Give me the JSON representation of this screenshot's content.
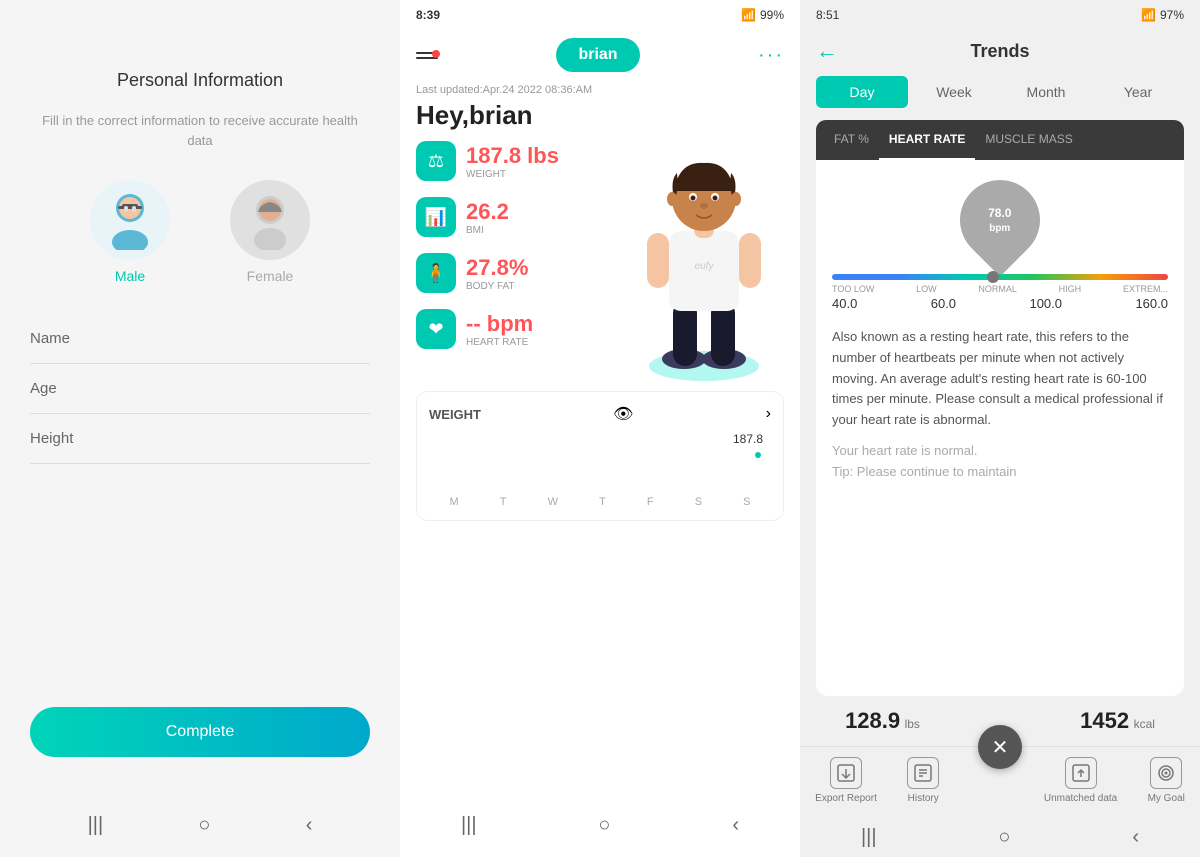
{
  "panel1": {
    "title": "Personal Information",
    "subtitle": "Fill in the correct information to receive accurate health data",
    "genders": [
      {
        "label": "Male",
        "active": true
      },
      {
        "label": "Female",
        "active": false
      }
    ],
    "fields": [
      {
        "label": "Name",
        "placeholder": "Name"
      },
      {
        "label": "Age",
        "placeholder": "Age"
      },
      {
        "label": "Height",
        "placeholder": "Height"
      }
    ],
    "complete_btn": "Complete",
    "nav": [
      "|||",
      "○",
      "‹"
    ]
  },
  "panel2": {
    "status_bar": {
      "time": "8:39",
      "battery": "99%"
    },
    "user_name": "brian",
    "last_updated": "Last updated:Apr.24 2022 08:36:AM",
    "greeting": "Hey,brian",
    "metrics": [
      {
        "icon": "⚖",
        "value": "187.8 lbs",
        "label": "WEIGHT"
      },
      {
        "icon": "📊",
        "value": "26.2",
        "label": "BMI"
      },
      {
        "icon": "🧍",
        "value": "27.8%",
        "label": "Body Fat"
      },
      {
        "icon": "❤",
        "value": "-- bpm",
        "label": "Heart Rate"
      }
    ],
    "weight_section": {
      "title": "WEIGHT",
      "value": "187.8",
      "days": [
        "M",
        "T",
        "W",
        "T",
        "F",
        "S",
        "S"
      ]
    },
    "nav": [
      "|||",
      "○",
      "‹"
    ]
  },
  "panel3": {
    "status_bar": {
      "time": "8:51",
      "battery": "97%"
    },
    "title": "Trends",
    "period_tabs": [
      "Day",
      "Week",
      "Month",
      "Year"
    ],
    "active_period": "Day",
    "metric_tabs": [
      "FAT %",
      "HEART RATE",
      "MUSCLE MASS"
    ],
    "active_metric": "HEART RATE",
    "heart_rate": {
      "value": "78.0",
      "unit": "bpm",
      "gauge_labels": [
        "TOO LOW",
        "LOW",
        "NORMAL",
        "HIGH",
        "EXTREM..."
      ],
      "gauge_numbers": [
        "40.0",
        "60.0",
        "100.0",
        "160.0"
      ],
      "description": "Also known as a resting heart rate, this refers to the number of heartbeats per minute when not actively moving. An average adult's resting heart rate is 60-100 times per minute. Please consult a medical professional if your heart rate is abnormal.",
      "status": "Your heart rate is normal.",
      "tip": "Tip: Please continue to maintain"
    },
    "bottom_stats": [
      {
        "value": "128.9",
        "unit": "lbs"
      },
      {
        "value": "1452",
        "unit": "kcal"
      }
    ],
    "bottom_nav": [
      {
        "icon": "📤",
        "label": "Export Report"
      },
      {
        "icon": "📋",
        "label": "History"
      },
      {
        "icon": "🔄",
        "label": "Unmatched data"
      },
      {
        "icon": "🎯",
        "label": "My Goal"
      }
    ],
    "sys_nav": [
      "|||",
      "○",
      "‹"
    ]
  }
}
